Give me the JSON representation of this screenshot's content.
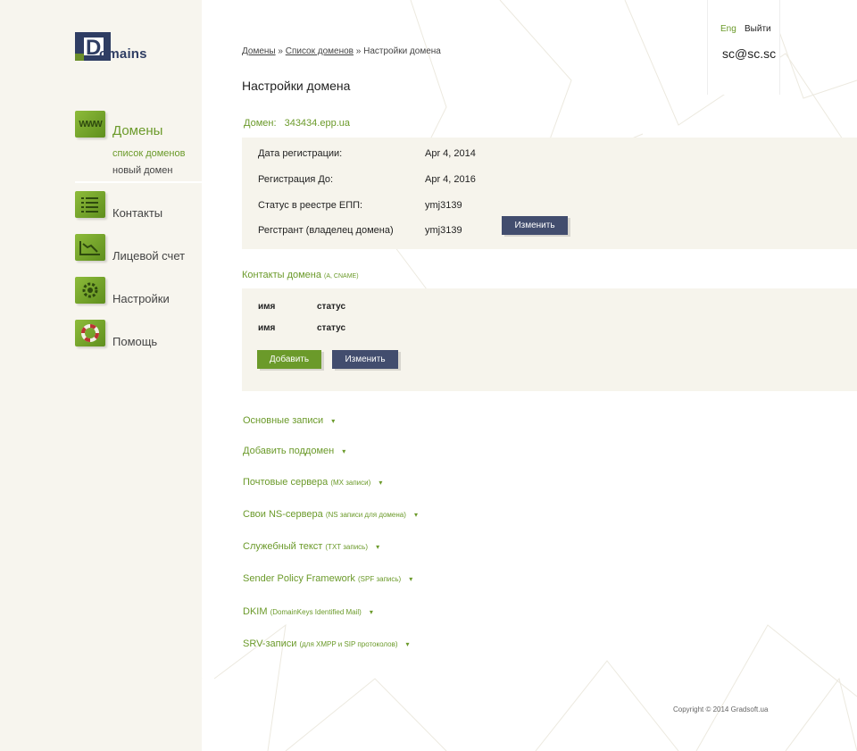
{
  "logo": {
    "letter": "D",
    "text": "omains"
  },
  "header": {
    "lang": "Eng",
    "logout": "Выйти",
    "email": "sc@sc.sc"
  },
  "breadcrumb": {
    "items": [
      "Домены",
      "Список доменов",
      "Настройки домена"
    ],
    "sep": "»"
  },
  "page_title": "Настройки домена",
  "sidebar": {
    "items": [
      {
        "label": "Домены",
        "icon": "www-icon",
        "icon_text": "WWW"
      },
      {
        "label": "Контакты",
        "icon": "list-icon"
      },
      {
        "label": "Лицевой счет",
        "icon": "chart-icon"
      },
      {
        "label": "Настройки",
        "icon": "gear-icon"
      },
      {
        "label": "Помощь",
        "icon": "lifebuoy-icon"
      }
    ],
    "sub_items": [
      "список доменов",
      "новый домен"
    ]
  },
  "domain": {
    "label": "Домен:",
    "name": "343434.epp.ua"
  },
  "info": {
    "rows": [
      {
        "label": "Дата регистрации:",
        "value": "Apr 4, 2014"
      },
      {
        "label": "Регистрация До:",
        "value": "Apr 4, 2016"
      },
      {
        "label": "Статус в реестре ЕПП:",
        "value": "ymj3139"
      },
      {
        "label": "Регстрант (владелец домена)",
        "value": "ymj3139"
      }
    ],
    "edit_button": "Изменить"
  },
  "contacts": {
    "title": "Контакты домена",
    "title_small": "(A, CNAME)",
    "rows": [
      {
        "name": "имя",
        "status": "статус"
      },
      {
        "name": "имя",
        "status": "статус"
      }
    ],
    "add_button": "Добавить",
    "edit_button": "Изменить"
  },
  "accordion": [
    {
      "title": "Основные записи",
      "small": ""
    },
    {
      "title": "Добавить поддомен",
      "small": ""
    },
    {
      "title": "Почтовые сервера",
      "small": "(MX записи)"
    },
    {
      "title": "Свои NS-сервера",
      "small": "(NS записи для домена)"
    },
    {
      "title": "Служебный текст",
      "small": "(TXT запись)"
    },
    {
      "title": "Sender Policy Framework",
      "small": "(SPF запись)"
    },
    {
      "title": "DKIM",
      "small": "(DomainKeys Identified Mail)"
    },
    {
      "title": "SRV-записи",
      "small": "(для XMPP и SIP протоколов)"
    }
  ],
  "chevron": "▾",
  "copyright": "Copyright ©  2014 Gradsoft.ua",
  "colors": {
    "accent": "#6b9a2a",
    "navy": "#2f3d63",
    "panel": "#f6f4ec",
    "sidebar": "#f7f5ee"
  }
}
